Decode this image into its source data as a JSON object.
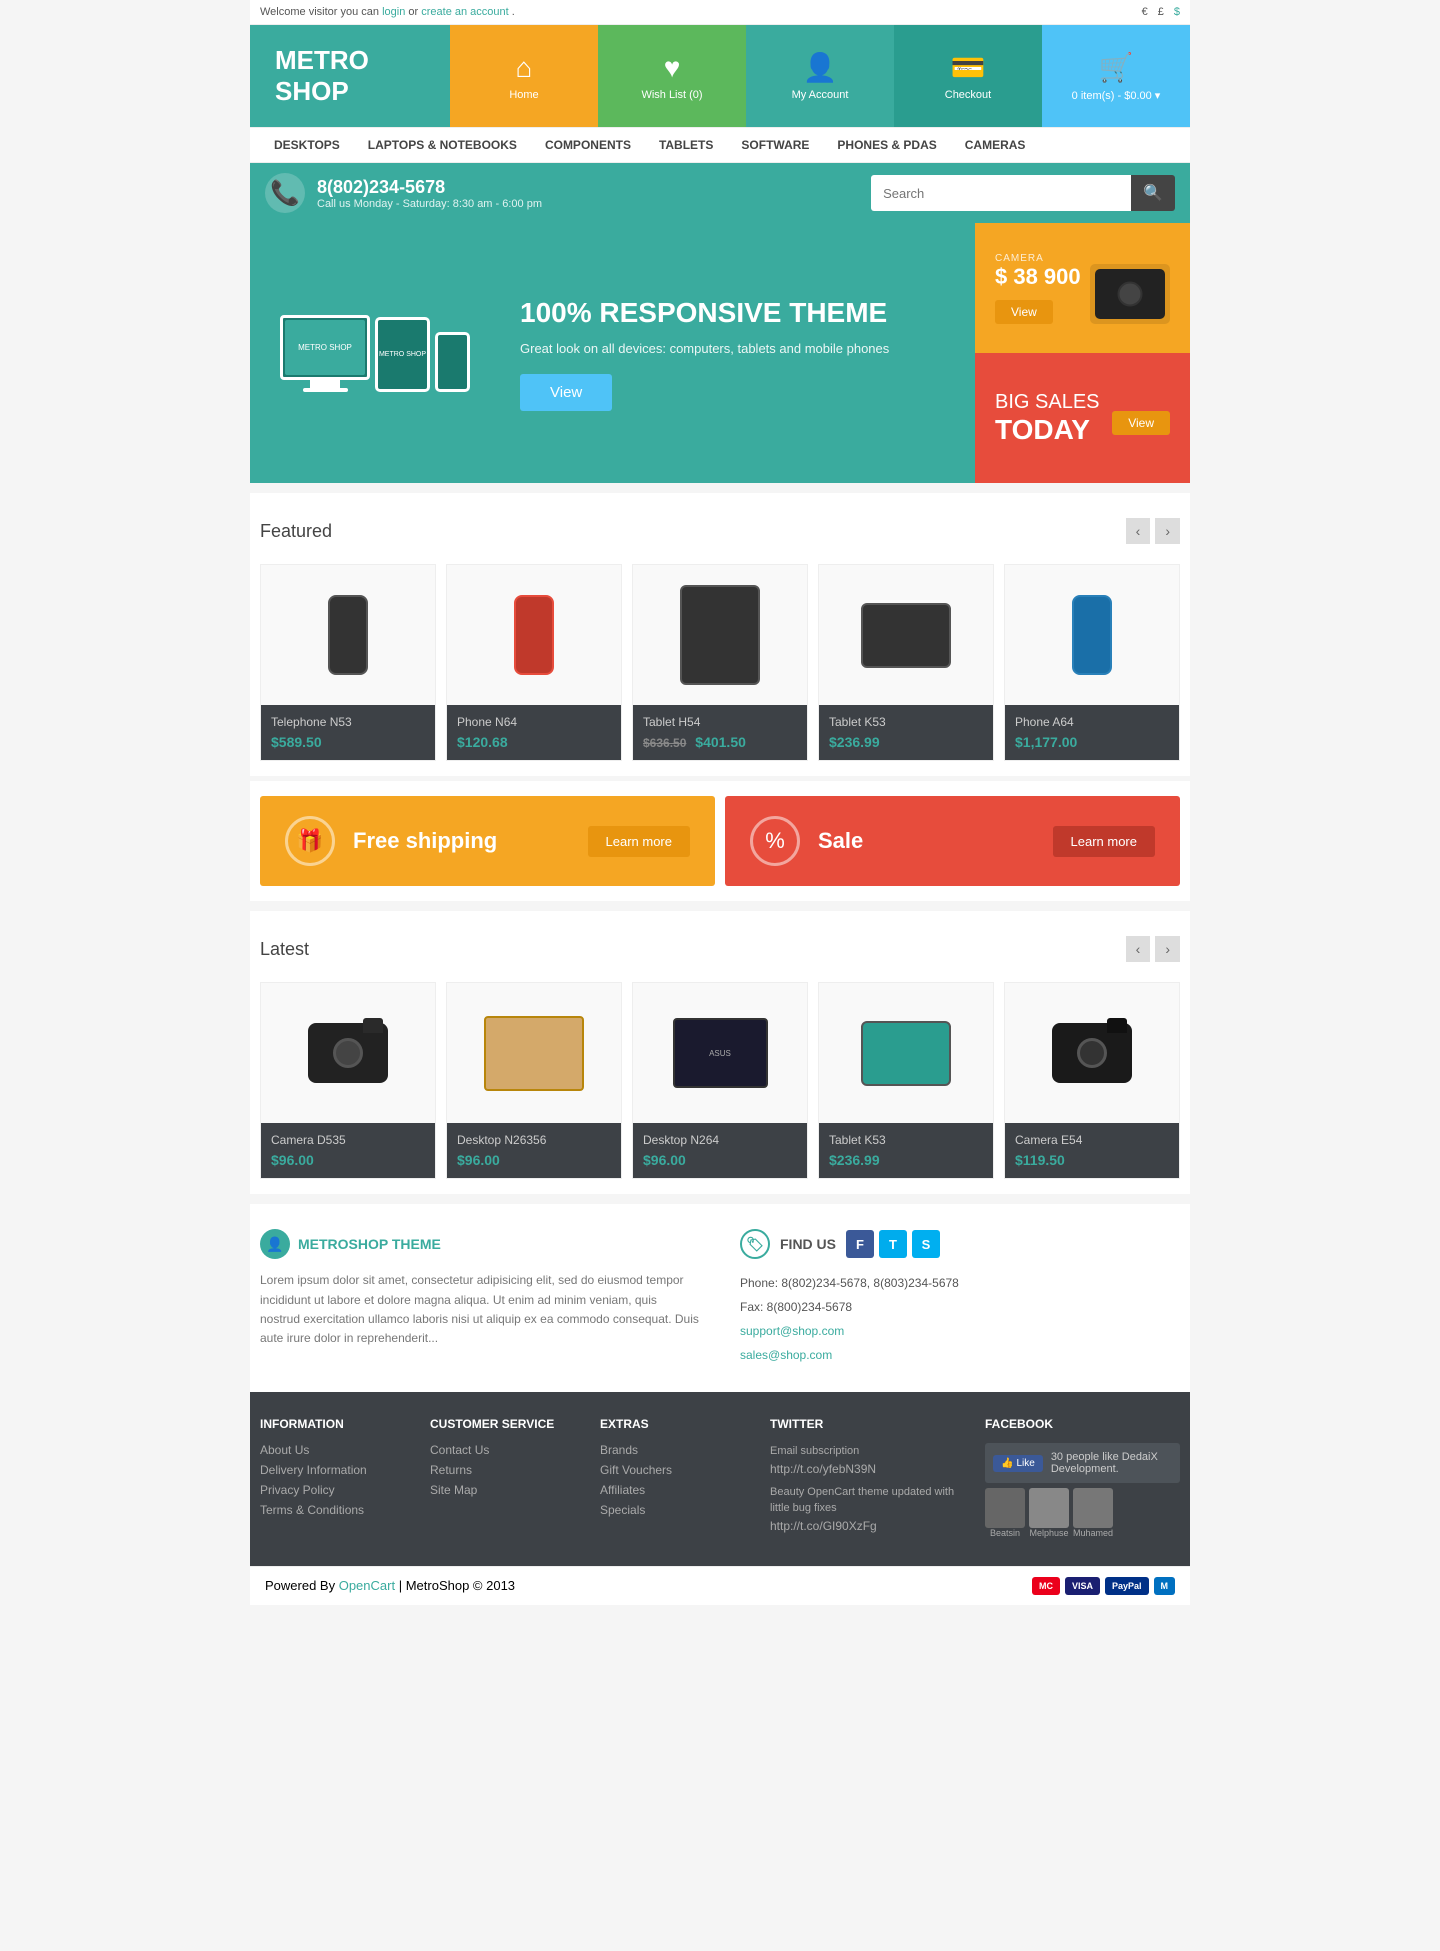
{
  "topbar": {
    "welcome_text": "Welcome visitor you can",
    "login_text": "login",
    "or_text": "or",
    "register_text": "create an account",
    "end_text": ".",
    "currency_euro": "€",
    "currency_pound": "£",
    "currency_dollar": "$"
  },
  "header": {
    "logo_line1": "METRO",
    "logo_line2": "SHOP",
    "nav_home": "Home",
    "nav_wishlist": "Wish List (0)",
    "nav_account": "My Account",
    "nav_checkout": "Checkout",
    "nav_cart": "0 item(s) - $0.00 ▾"
  },
  "mainnav": {
    "items": [
      "DESKTOPS",
      "LAPTOPS & NOTEBOOKS",
      "COMPONENTS",
      "TABLETS",
      "SOFTWARE",
      "PHONES & PDAS",
      "CAMERAS"
    ]
  },
  "searchbar": {
    "phone": "8(802)234-5678",
    "hours": "Call us Monday - Saturday: 8:30 am - 6:00 pm",
    "search_placeholder": "Search"
  },
  "hero": {
    "headline": "100% RESPONSIVE THEME",
    "subtext": "Great look on all devices: computers, tablets and mobile phones",
    "view_btn": "View",
    "camera_label": "CAMERA",
    "camera_price": "$ 38 900",
    "camera_view_btn": "View",
    "sale_line1": "BIG SALES",
    "sale_line2": "TODAY",
    "sale_view_btn": "View"
  },
  "featured": {
    "title": "Featured",
    "prev": "‹",
    "next": "›",
    "products": [
      {
        "name": "Telephone N53",
        "price": "$589.50",
        "old_price": ""
      },
      {
        "name": "Phone N64",
        "price": "$120.68",
        "old_price": ""
      },
      {
        "name": "Tablet H54",
        "price": "$401.50",
        "old_price": "$636.50"
      },
      {
        "name": "Tablet K53",
        "price": "$236.99",
        "old_price": ""
      },
      {
        "name": "Phone A64",
        "price": "$1,177.00",
        "old_price": ""
      }
    ]
  },
  "promo": {
    "shipping_text": "Free shipping",
    "shipping_btn": "Learn more",
    "sale_text": "Sale",
    "sale_btn": "Learn more"
  },
  "latest": {
    "title": "Latest",
    "prev": "‹",
    "next": "›",
    "products": [
      {
        "name": "Camera D535",
        "price": "$96.00",
        "old_price": ""
      },
      {
        "name": "Desktop N26356",
        "price": "$96.00",
        "old_price": ""
      },
      {
        "name": "Desktop N264",
        "price": "$96.00",
        "old_price": ""
      },
      {
        "name": "Tablet K53",
        "price": "$236.99",
        "old_price": ""
      },
      {
        "name": "Camera E54",
        "price": "$119.50",
        "old_price": ""
      }
    ]
  },
  "footer_info": {
    "brand_icon": "👤",
    "brand_title": "METROSHOP THEME",
    "brand_text": "Lorem ipsum dolor sit amet, consectetur adipisicing elit, sed do eiusmod tempor incididunt ut labore et dolore magna aliqua. Ut enim ad minim veniam, quis nostrud exercitation ullamco laboris nisi ut aliquip ex ea commodo consequat. Duis aute irure dolor in reprehenderit...",
    "find_us_title": "FIND US",
    "phone": "Phone: 8(802)234-5678, 8(803)234-5678",
    "fax": "Fax: 8(800)234-5678",
    "email1": "support@shop.com",
    "email2": "sales@shop.com"
  },
  "footer_columns": {
    "info_title": "INFORMATION",
    "info_links": [
      "About Us",
      "Delivery Information",
      "Privacy Policy",
      "Terms & Conditions"
    ],
    "service_title": "CUSTOMER SERVICE",
    "service_links": [
      "Contact Us",
      "Returns",
      "Site Map"
    ],
    "extras_title": "EXTRAS",
    "extras_links": [
      "Brands",
      "Gift Vouchers",
      "Affiliates",
      "Specials"
    ],
    "twitter_title": "TWITTER",
    "twitter_sub": "Email subscription",
    "twitter_link1": "http://t.co/yfebN39N",
    "twitter_text": "Beauty OpenCart theme updated with little bug fixes",
    "twitter_link2": "http://t.co/GI90XzFg",
    "facebook_title": "FACEBOOK",
    "fb_like_text": "Like",
    "fb_user": "30 people like DedaiX Development.",
    "fb_name1": "Beatsin",
    "fb_name2": "Melphuse",
    "fb_name3": "Muhamed"
  },
  "very_bottom": {
    "powered_by": "Powered By",
    "opencart": "OpenCart",
    "copyright": "MetroShop © 2013",
    "payments": [
      "MasterCard",
      "VISA",
      "PayPal",
      "Maestro"
    ]
  }
}
